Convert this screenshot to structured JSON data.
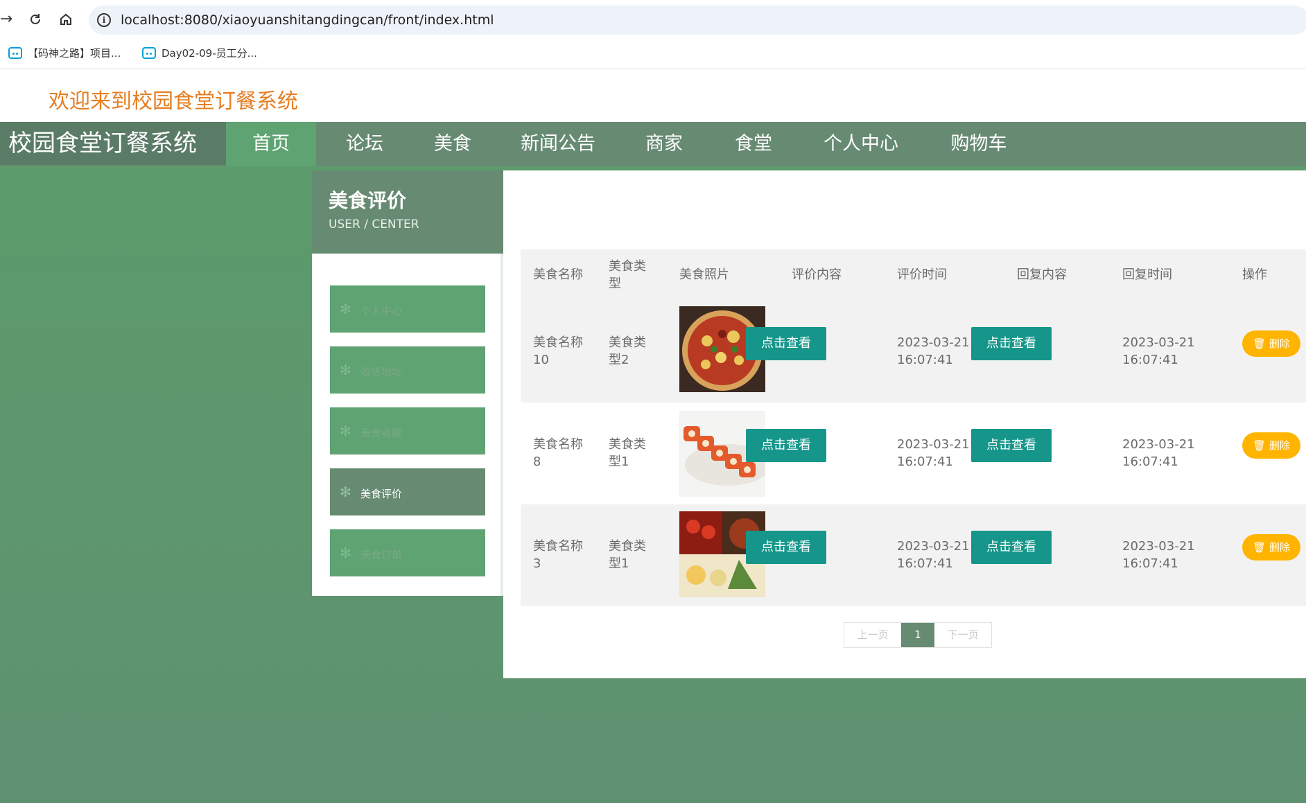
{
  "browser": {
    "url": "localhost:8080/xiaoyuanshitangdingcan/front/index.html",
    "bookmarks": [
      {
        "label": "【码神之路】项目..."
      },
      {
        "label": "Day02-09-员工分..."
      }
    ]
  },
  "site": {
    "welcome": "欢迎来到校园食堂订餐系统",
    "brand": "校园食堂订餐系统",
    "nav": [
      "首页",
      "论坛",
      "美食",
      "新闻公告",
      "商家",
      "食堂",
      "个人中心",
      "购物车"
    ],
    "active_nav": "首页"
  },
  "sidebar": {
    "title": "美食评价",
    "subtitle": "USER / CENTER",
    "items": [
      {
        "label": "个人中心"
      },
      {
        "label": "收货地址"
      },
      {
        "label": "美食收藏"
      },
      {
        "label": "美食评价"
      },
      {
        "label": "美食订单"
      }
    ],
    "active": "美食评价"
  },
  "table": {
    "columns": [
      "美食名称",
      "美食类型",
      "美食照片",
      "评价内容",
      "评价时间",
      "回复内容",
      "回复时间",
      "操作"
    ],
    "rows": [
      {
        "name": "美食名称10",
        "type": "美食类型2",
        "photo": "pizza",
        "content_btn": "点击查看",
        "time": "2023-03-21 16:07:41",
        "reply_btn": "点击查看",
        "reply_time": "2023-03-21 16:07:41",
        "action": "删除"
      },
      {
        "name": "美食名称8",
        "type": "美食类型1",
        "photo": "sushi",
        "content_btn": "点击查看",
        "time": "2023-03-21 16:07:41",
        "reply_btn": "点击查看",
        "reply_time": "2023-03-21 16:07:41",
        "action": "删除"
      },
      {
        "name": "美食名称3",
        "type": "美食类型1",
        "photo": "platter",
        "content_btn": "点击查看",
        "time": "2023-03-21 16:07:41",
        "reply_btn": "点击查看",
        "reply_time": "2023-03-21 16:07:41",
        "action": "删除"
      }
    ]
  },
  "pager": {
    "prev": "上一页",
    "current": "1",
    "next": "下一页"
  },
  "colors": {
    "nav_bg": "#678a72",
    "accent": "#5fa373",
    "btn_view": "#16968a",
    "btn_delete": "#ffb400",
    "welcome": "#e67e22"
  }
}
